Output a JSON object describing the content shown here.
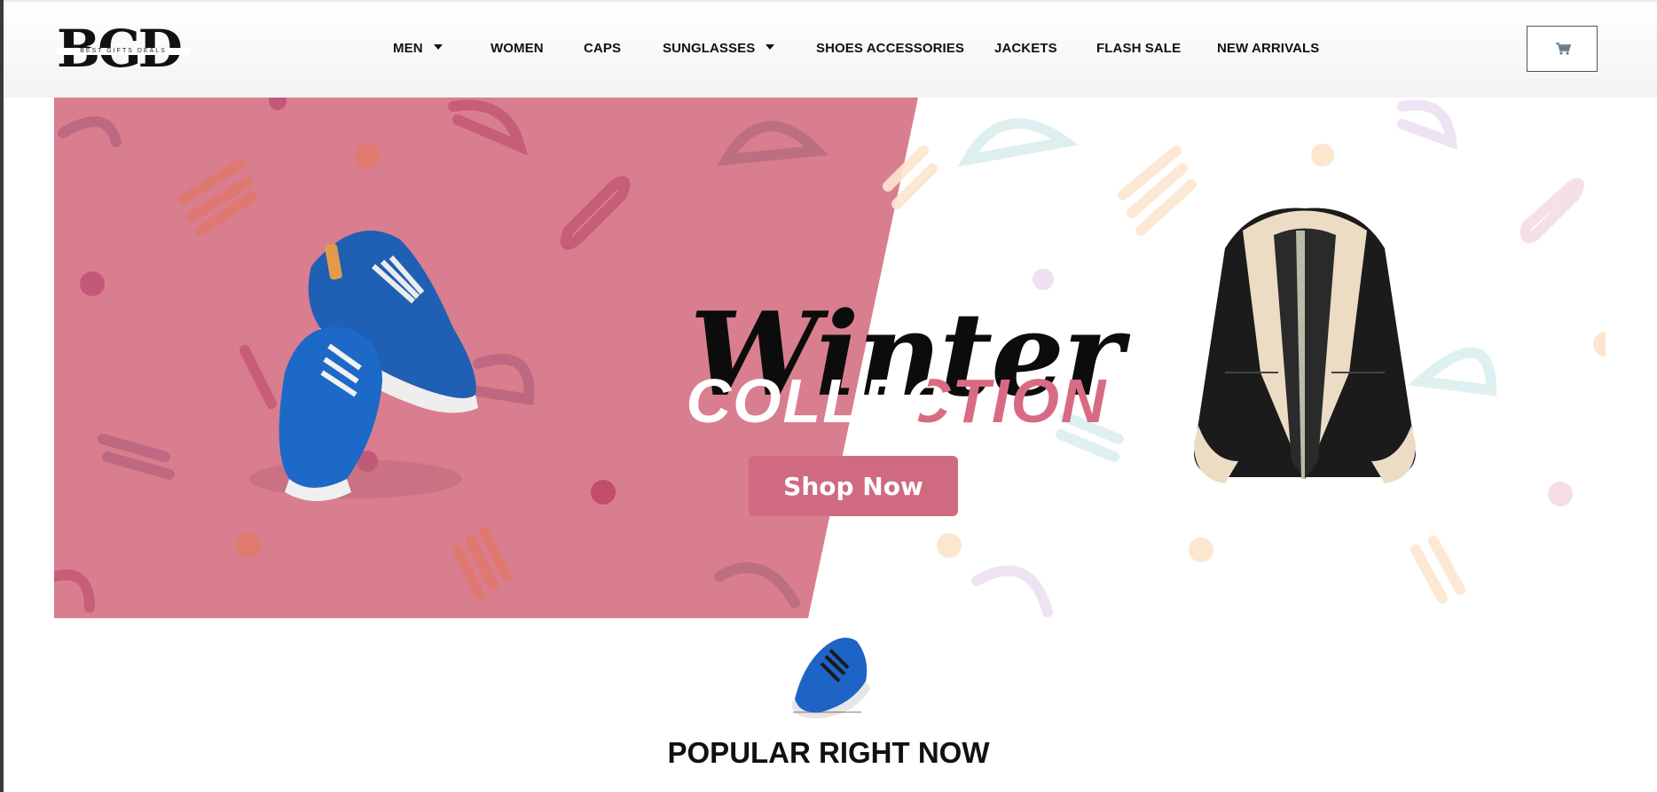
{
  "brand": {
    "logo_letters": "BGD",
    "logo_tagline": "BEST GIFTS DEALS"
  },
  "nav": {
    "items": [
      {
        "label": "MEN",
        "has_dropdown": true
      },
      {
        "label": "WOMEN",
        "has_dropdown": false
      },
      {
        "label": "CAPS",
        "has_dropdown": false
      },
      {
        "label": "SUNGLASSES",
        "has_dropdown": true
      },
      {
        "label": "SHOES ACCESSORIES",
        "has_dropdown": false
      },
      {
        "label": "JACKETS",
        "has_dropdown": false
      },
      {
        "label": "FLASH SALE",
        "has_dropdown": false
      },
      {
        "label": "NEW ARRIVALS",
        "has_dropdown": false
      }
    ],
    "cart_icon": "shopping-cart-icon"
  },
  "hero": {
    "headline": "Winter",
    "subheadline": "COLLECTION",
    "cta_label": "Shop Now",
    "colors": {
      "pink_panel": "#d97e8e",
      "cta": "#cf6a80",
      "accent_text": "#d86b84"
    }
  },
  "popular": {
    "title": "POPULAR RIGHT NOW"
  }
}
